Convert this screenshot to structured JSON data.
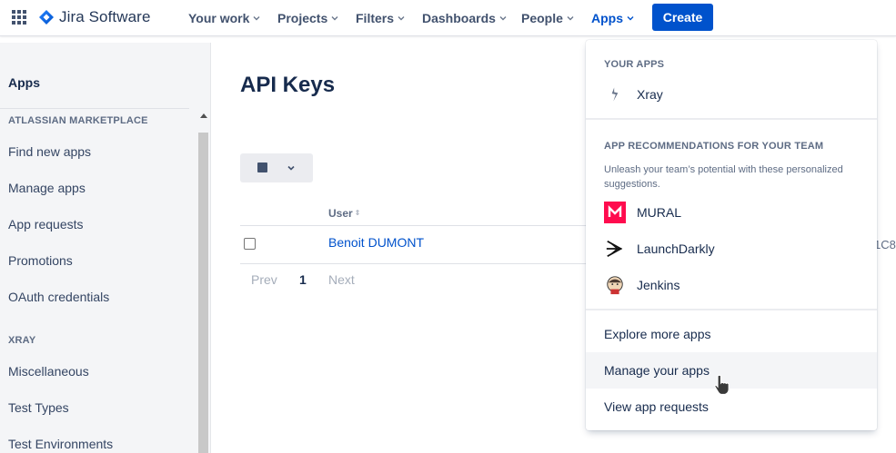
{
  "topnav": {
    "logo_text": "Jira Software",
    "items": [
      {
        "label": "Your work"
      },
      {
        "label": "Projects"
      },
      {
        "label": "Filters"
      },
      {
        "label": "Dashboards"
      },
      {
        "label": "People"
      },
      {
        "label": "Apps"
      }
    ],
    "create_label": "Create",
    "brand_color": "#0052cc"
  },
  "sidebar": {
    "title": "Apps",
    "sections": [
      {
        "heading": "ATLASSIAN MARKETPLACE",
        "items": [
          "Find new apps",
          "Manage apps",
          "App requests",
          "Promotions",
          "OAuth credentials"
        ]
      },
      {
        "heading": "XRAY",
        "items": [
          "Miscellaneous",
          "Test Types",
          "Test Environments"
        ]
      }
    ]
  },
  "main": {
    "title": "API Keys",
    "table": {
      "headers": [
        "User"
      ],
      "rows": [
        {
          "user": "Benoit DUMONT",
          "overflow_text": "1C8"
        }
      ]
    },
    "pagination": {
      "prev": "Prev",
      "current": "1",
      "next": "Next"
    }
  },
  "apps_menu": {
    "your_apps_heading": "YOUR APPS",
    "your_apps": [
      {
        "label": "Xray",
        "icon": "xray-icon"
      }
    ],
    "recommend_heading": "APP RECOMMENDATIONS FOR YOUR TEAM",
    "recommend_desc": "Unleash your team’s potential with these personalized suggestions.",
    "recommended": [
      {
        "label": "MURAL",
        "icon": "mural-icon"
      },
      {
        "label": "LaunchDarkly",
        "icon": "launchdarkly-icon"
      },
      {
        "label": "Jenkins",
        "icon": "jenkins-icon"
      }
    ],
    "links": [
      "Explore more apps",
      "Manage your apps",
      "View app requests"
    ]
  }
}
